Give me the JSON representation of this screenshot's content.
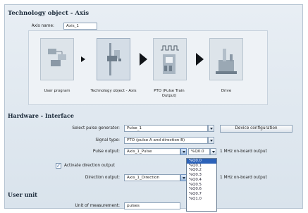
{
  "header": {
    "title": "Technology object - Axis",
    "axis_name_label": "Axis name:",
    "axis_name_value": "Axis_1"
  },
  "diagram": {
    "nodes": [
      {
        "label": "User program"
      },
      {
        "label": "Technology object - Axis"
      },
      {
        "label": "PTO (Pulse Train Output)"
      },
      {
        "label": "Drive"
      }
    ]
  },
  "hardware": {
    "section_title": "Hardware - Interface",
    "pulse_generator_label": "Select pulse generator:",
    "pulse_generator_value": "Pulse_1",
    "device_config_button": "Device configuration",
    "signal_type_label": "Signal type:",
    "signal_type_value": "PTO (pulse A and direction B)",
    "pulse_output_label": "Pulse output:",
    "pulse_output_value": "Axis_1_Pulse",
    "pulse_output_address": "%Q0.0",
    "pulse_output_note": "1 MHz on-board output",
    "activate_direction_label": "Activate direction output",
    "activate_direction_checked": true,
    "direction_output_label": "Direction output:",
    "direction_output_value": "Axis_1_Direction",
    "direction_output_note": "1 MHz on-board output"
  },
  "address_dropdown": {
    "options": [
      "%Q0.0",
      "%Q0.1",
      "%Q0.2",
      "%Q0.3",
      "%Q0.4",
      "%Q0.5",
      "%Q0.6",
      "%Q0.7",
      "%Q1.0"
    ],
    "selected_index": 0
  },
  "user_unit": {
    "section_title": "User unit",
    "unit_label": "Unit of measurement:",
    "unit_value": "pulses"
  }
}
